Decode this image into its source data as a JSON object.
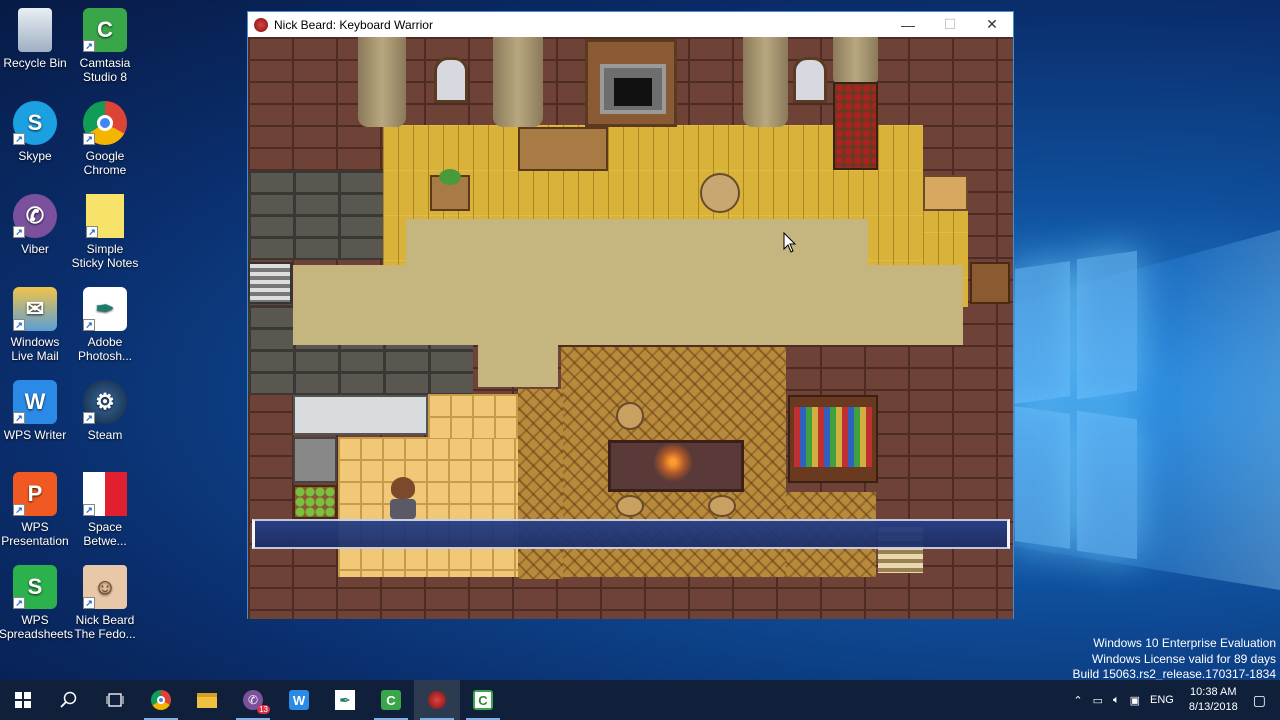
{
  "desktop": {
    "icons": [
      {
        "label": "Recycle Bin",
        "icon": "recycle-bin-icon"
      },
      {
        "label": "Camtasia Studio 8",
        "icon": "camtasia-icon"
      },
      {
        "label": "Skype",
        "icon": "skype-icon"
      },
      {
        "label": "Google Chrome",
        "icon": "chrome-icon"
      },
      {
        "label": "Viber",
        "icon": "viber-icon"
      },
      {
        "label": "Simple Sticky Notes",
        "icon": "sticky-notes-icon"
      },
      {
        "label": "Windows Live Mail",
        "icon": "live-mail-icon"
      },
      {
        "label": "Adobe Photosh...",
        "icon": "photoshop-icon"
      },
      {
        "label": "WPS Writer",
        "icon": "wps-writer-icon"
      },
      {
        "label": "Steam",
        "icon": "steam-icon"
      },
      {
        "label": "WPS Presentation",
        "icon": "wps-presentation-icon"
      },
      {
        "label": "Space Betwe...",
        "icon": "space-between-icon"
      },
      {
        "label": "WPS Spreadsheets",
        "icon": "wps-spreadsheets-icon"
      },
      {
        "label": "Nick Beard The Fedo...",
        "icon": "nick-beard-icon"
      }
    ]
  },
  "window": {
    "title": "Nick Beard: Keyboard Warrior",
    "minimize": "—",
    "maximize": "☐",
    "close": "✕"
  },
  "watermark": {
    "line1": "Windows 10 Enterprise Evaluation",
    "line2": "Windows License valid for 89 days",
    "line3": "Build 15063.rs2_release.170317-1834"
  },
  "taskbar": {
    "tray_language": "ENG",
    "time": "10:38 AM",
    "date": "8/13/2018",
    "viber_badge": "13",
    "buttons": [
      "start-icon",
      "search-icon",
      "task-view-icon",
      "chrome-icon",
      "file-explorer-icon",
      "viber-icon",
      "wps-writer-icon",
      "photoshop-icon",
      "camtasia-icon",
      "game-icon",
      "camtasia-recorder-icon"
    ]
  },
  "colors": {
    "wall_brick": "#6e4236",
    "floor_plank": "#d9b23a",
    "carpet": "#c4b67e",
    "message_box": "#263f86",
    "taskbar": "#10203a"
  }
}
